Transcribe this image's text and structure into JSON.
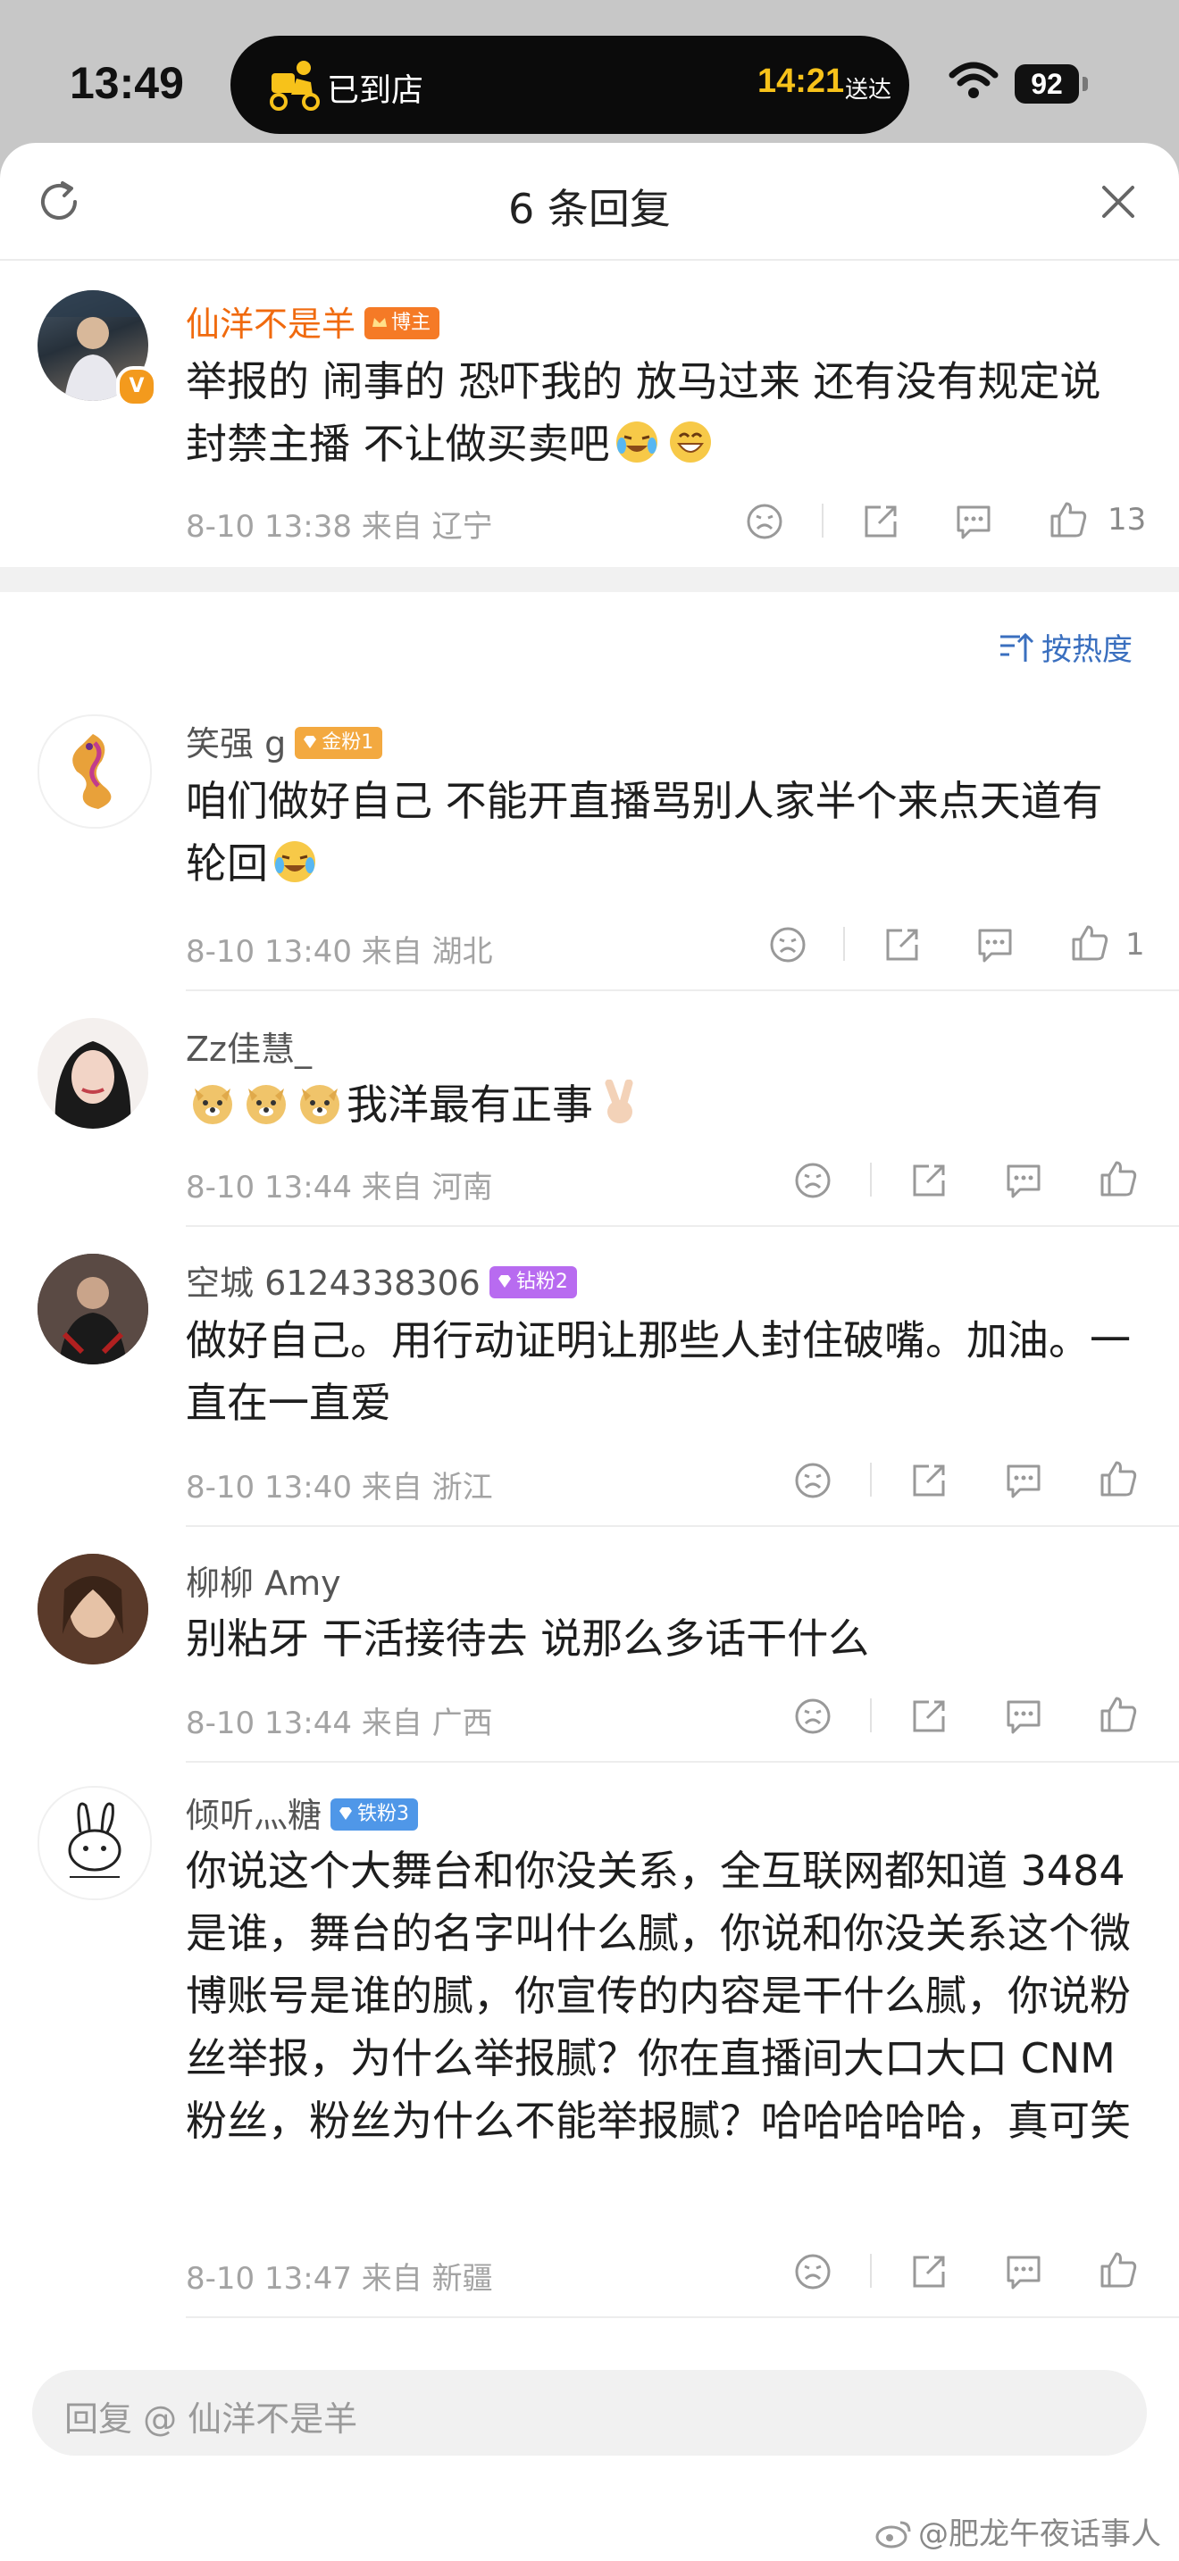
{
  "status_bar": {
    "time": "13:49",
    "island_status": "已到店",
    "eta_time": "14:21",
    "eta_label": "送达",
    "battery": "92"
  },
  "header": {
    "title": "6 条回复"
  },
  "op_comment": {
    "author": "仙洋不是羊",
    "badge": "博主",
    "text": "举报的 闹事的 恐吓我的 放马过来 还有没有规定说封禁主播 不让做买卖吧",
    "meta": "8-10 13:38 来自 辽宁",
    "likes": "13"
  },
  "sort_label": "按热度",
  "replies": [
    {
      "author": "笑强 g",
      "badge": "金粉1",
      "text": "咱们做好自己  不能开直播骂别人家半个来点天道有轮回",
      "meta": "8-10 13:40 来自 湖北",
      "likes": "1"
    },
    {
      "author": "Zz佳慧_",
      "badge": "",
      "text": "我洋最有正事",
      "meta": "8-10 13:44 来自 河南",
      "likes": ""
    },
    {
      "author": "空城 6124338306",
      "badge": "钻粉2",
      "text": "做好自己。用行动证明让那些人封住破嘴。加油。一直在一直爱",
      "meta": "8-10 13:40 来自 浙江",
      "likes": ""
    },
    {
      "author": "柳柳 Amy",
      "badge": "",
      "text": "别粘牙 干活接待去  说那么多话干什么",
      "meta": "8-10 13:44 来自 广西",
      "likes": ""
    },
    {
      "author": "倾听灬糖",
      "badge": "铁粉3",
      "text": "你说这个大舞台和你没关系，全互联网都知道 3484是谁，舞台的名字叫什么腻，你说和你没关系这个微博账号是谁的腻，你宣传的内容是干什么腻，你说粉丝举报，为什么举报腻？你在直播间大口大口 CNM 粉丝，粉丝为什么不能举报腻？哈哈哈哈哈，真可笑",
      "meta": "8-10 13:47 来自 新疆",
      "likes": ""
    }
  ],
  "reply_box": {
    "placeholder": "回复 @ 仙洋不是羊"
  },
  "watermark": "@肥龙午夜话事人",
  "colors": {
    "accent_orange": "#f06a0e",
    "link_blue": "#3a6fbf",
    "gold_badge": "#f3a940",
    "diamond_badge": "#b86bf0",
    "iron_badge": "#4f97e8"
  }
}
